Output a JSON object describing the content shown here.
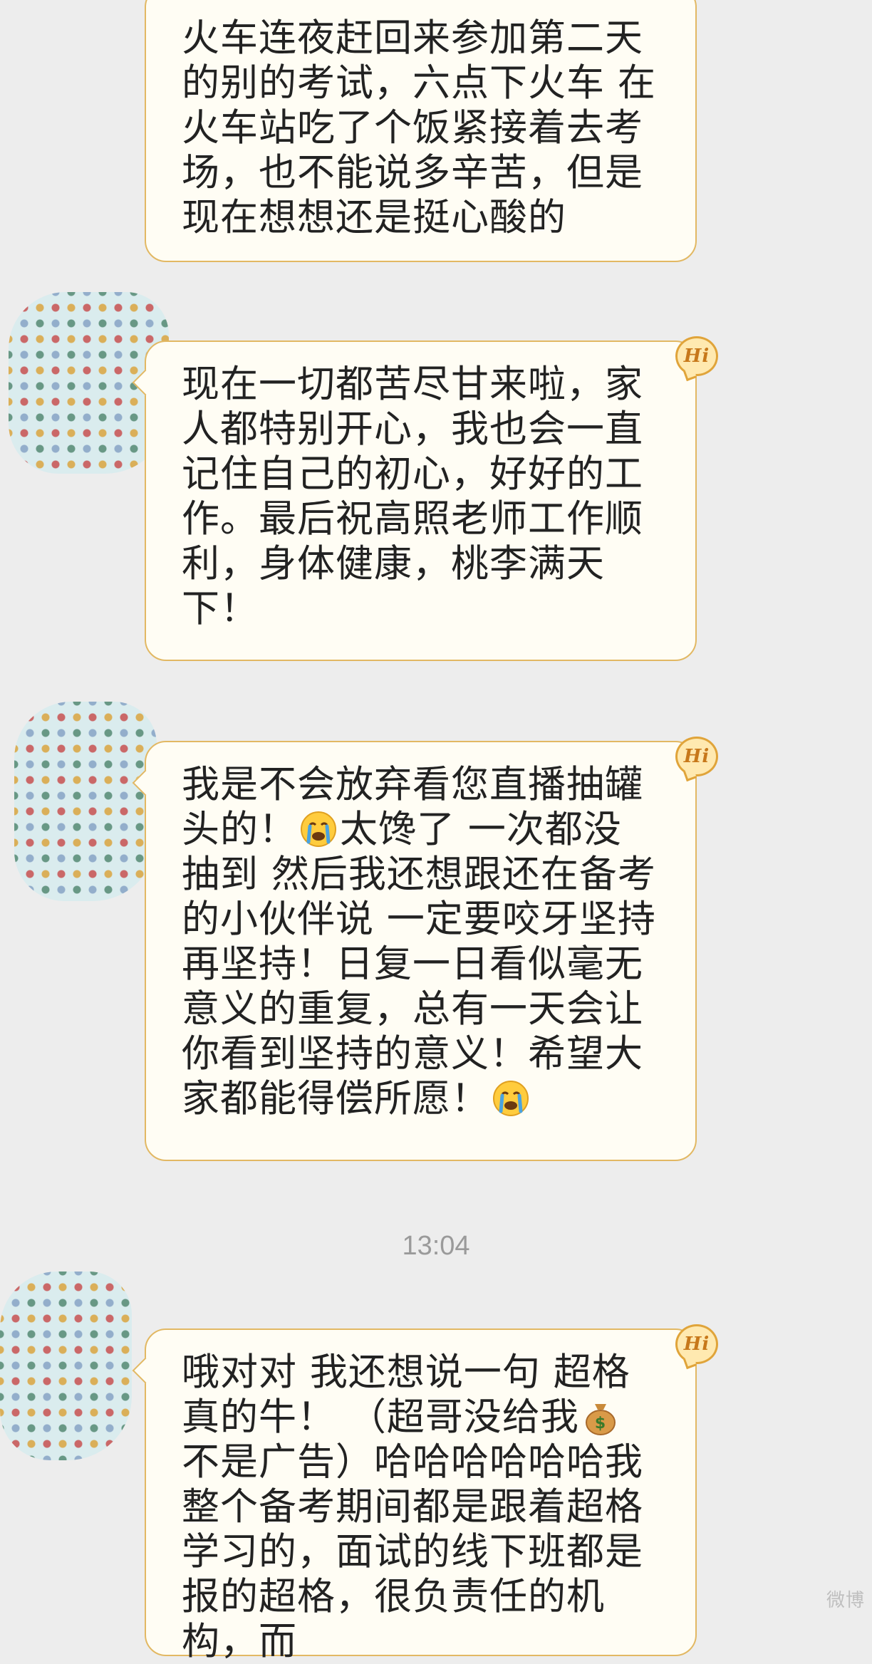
{
  "messages": [
    {
      "text": "火车连夜赶回来参加第二天的别的考试，六点下火车 在火车站吃了个饭紧接着去考场，也不能说多辛苦，但是现在想想还是挺心酸的"
    },
    {
      "badge": "Hi",
      "text": "现在一切都苦尽甘来啦，家人都特别开心，我也会一直记住自己的初心，好好的工作。最后祝高照老师工作顺利，身体健康，桃李满天下！"
    },
    {
      "badge": "Hi",
      "parts": [
        "我是不会放弃看您直播抽罐头的！",
        "太馋了 一次都没抽到 然后我还想跟还在备考的小伙伴说 一定要咬牙坚持再坚持！日复一日看似毫无意义的重复，总有一天会让你看到坚持的意义！希望大家都能得偿所愿！"
      ],
      "emoji": [
        "crying-face-icon",
        "crying-face-icon"
      ]
    },
    {
      "badge": "Hi",
      "parts": [
        "哦对对 我还想说一句 超格真的牛！ （超哥没给我",
        " 不是广告）哈哈哈哈哈哈我整个备考期间都是跟着超格学习的，面试的线下班都是报的超格，很负责任的机构，而"
      ],
      "emoji": [
        "money-bag-icon"
      ]
    }
  ],
  "timestamp": "13:04",
  "watermark": "微博"
}
